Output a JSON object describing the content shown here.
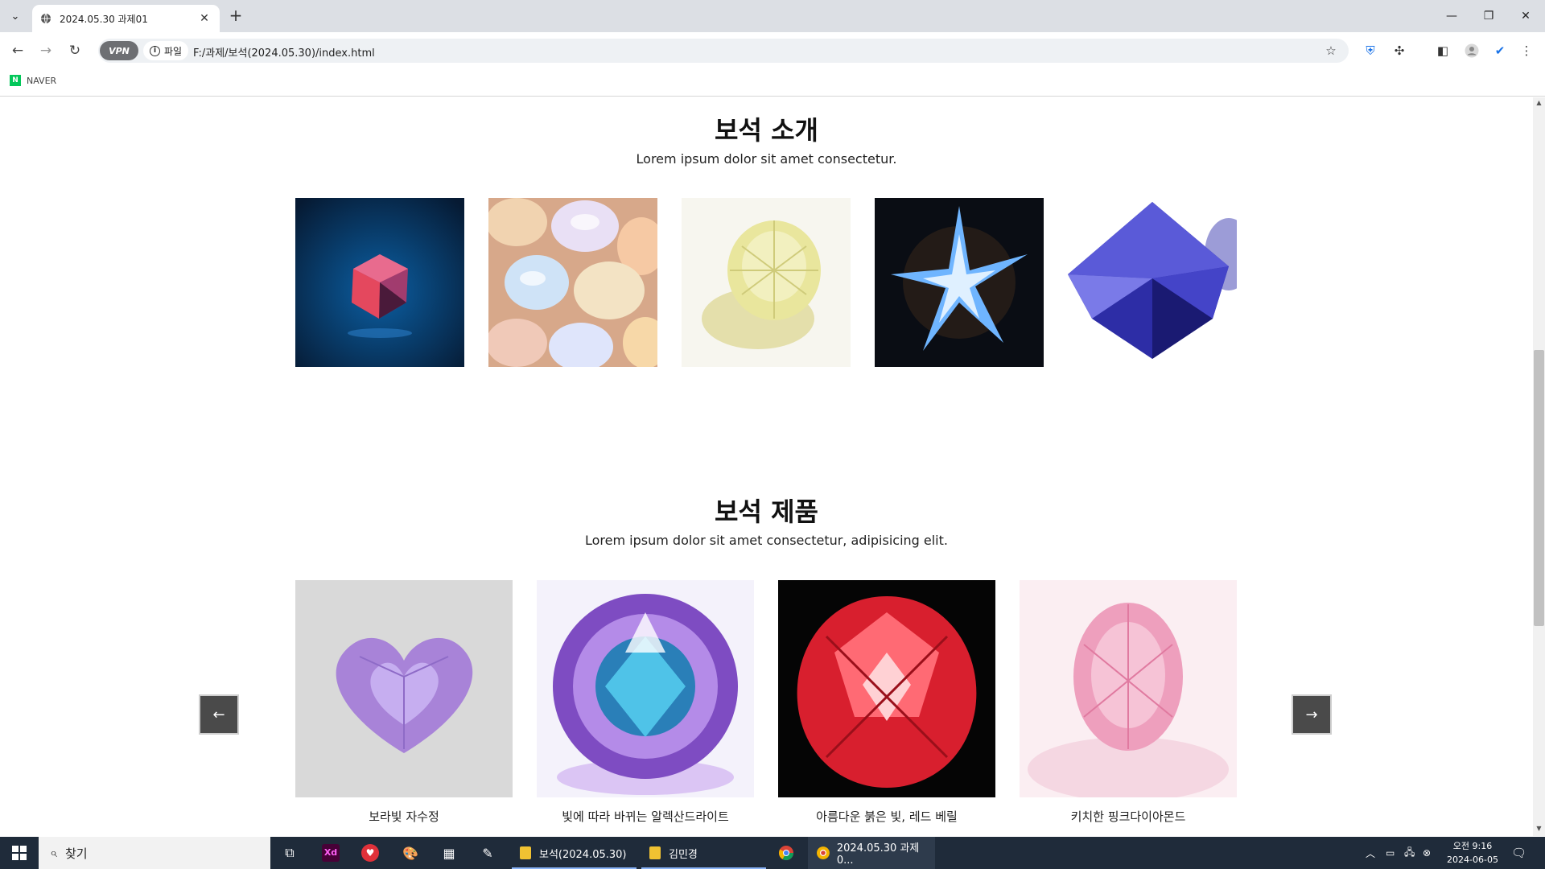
{
  "browser": {
    "tab_title": "2024.05.30 과제01",
    "url": "F:/과제/보석(2024.05.30)/index.html",
    "vpn_label": "VPN",
    "site_info_label": "파일",
    "bookmarks": [
      {
        "label": "NAVER"
      }
    ]
  },
  "intro": {
    "title": "보석 소개",
    "subtitle": "Lorem ipsum dolor sit amet consectetur.",
    "images": [
      {
        "icon": "gem-cube-image",
        "colors": [
          "#0a2540",
          "#0b4d86",
          "#e8436a"
        ]
      },
      {
        "icon": "opal-stones-image",
        "colors": [
          "#e8b98a",
          "#cfd6f5",
          "#f5e8c8"
        ]
      },
      {
        "icon": "yellow-diamond-image",
        "colors": [
          "#f4f2e6",
          "#e8e39a",
          "#cfcb7a"
        ]
      },
      {
        "icon": "crystal-burst-image",
        "colors": [
          "#0b0f18",
          "#6fb5ff",
          "#ffffff"
        ]
      },
      {
        "icon": "blue-sapphire-image",
        "colors": [
          "#ffffff",
          "#2a2aa8",
          "#6a6ae0"
        ]
      }
    ]
  },
  "products": {
    "title": "보석 제품",
    "subtitle": "Lorem ipsum dolor sit amet consectetur, adipisicing elit.",
    "items": [
      {
        "name": "보라빛 자수정",
        "icon": "amethyst-heart-image",
        "colors": [
          "#d9d9d9",
          "#b79ae0",
          "#8e6bc7"
        ]
      },
      {
        "name": "빛에 따라 바뀌는 알렉산드라이트",
        "icon": "alexandrite-image",
        "colors": [
          "#f4f2fb",
          "#2a7fb8",
          "#9c6ed8"
        ]
      },
      {
        "name": "아름다운 붉은 빛, 레드 베릴",
        "icon": "red-beryl-image",
        "colors": [
          "#050505",
          "#e0202e",
          "#ff7f86"
        ]
      },
      {
        "name": "키치한 핑크다이아몬드",
        "icon": "pink-diamond-image",
        "colors": [
          "#fbeef2",
          "#f2aac2",
          "#e57fa3"
        ]
      }
    ]
  },
  "taskbar": {
    "search_label": "찾기",
    "apps": [
      {
        "label": "보석(2024.05.30)"
      },
      {
        "label": "김민경"
      },
      {
        "label": "2024.05.30 과제0..."
      }
    ],
    "time": "오전 9:16",
    "date": "2024-06-05"
  }
}
